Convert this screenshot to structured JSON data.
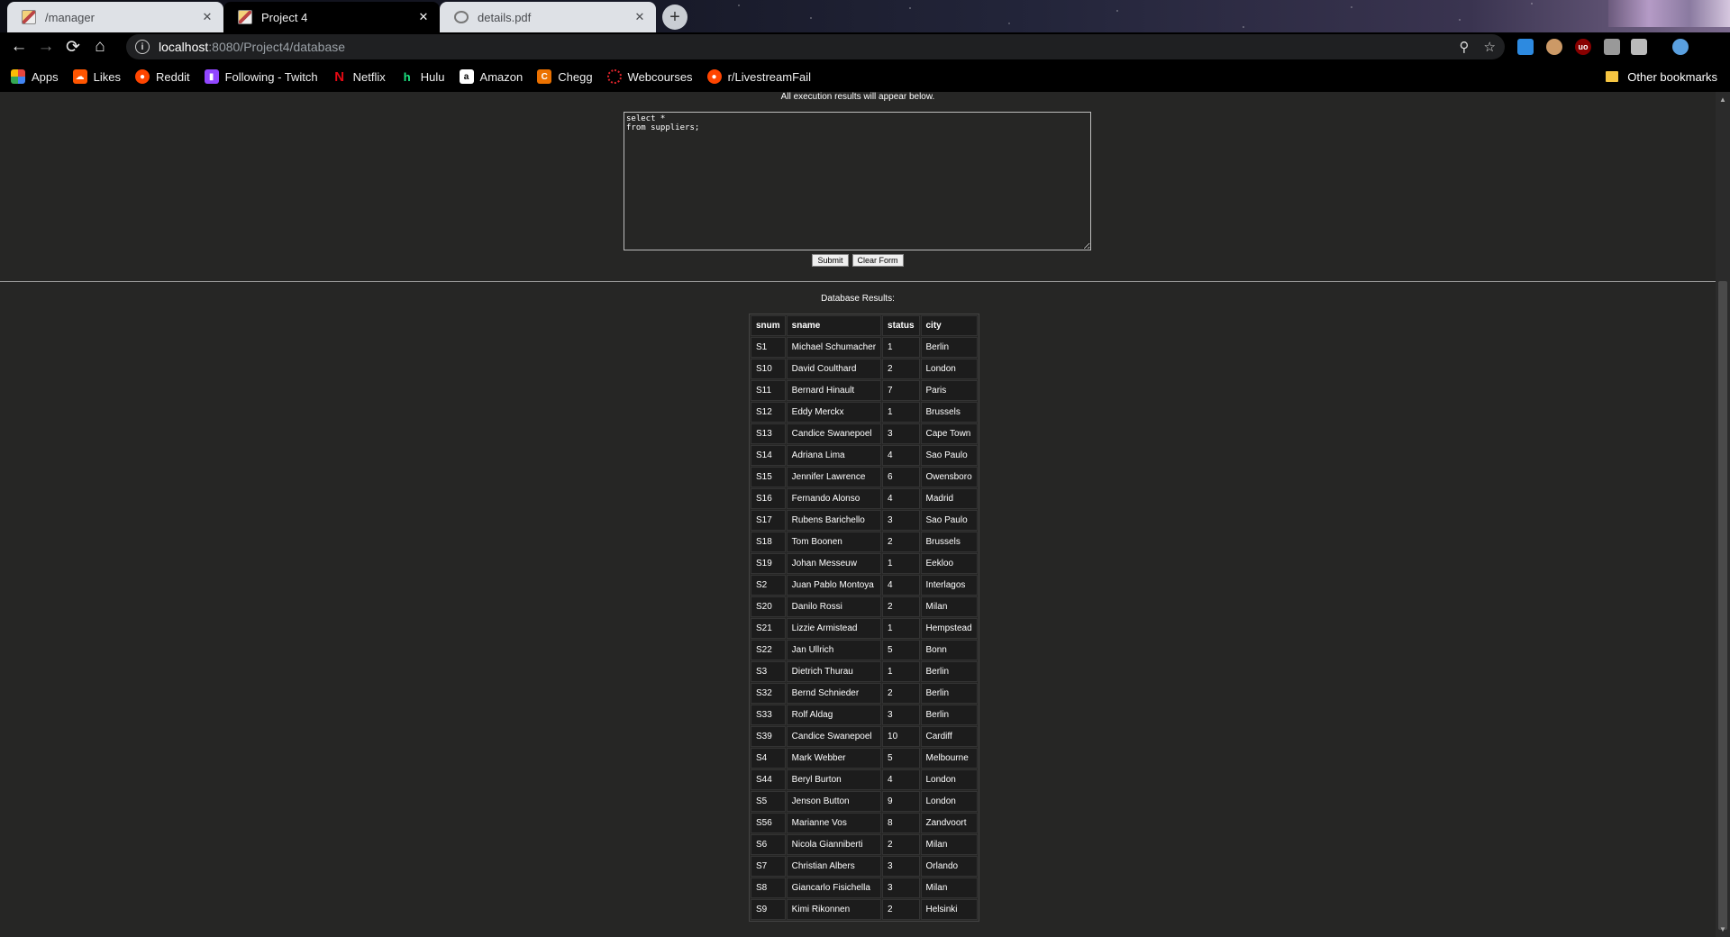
{
  "browser": {
    "tabs": [
      {
        "title": "/manager",
        "active": false,
        "icon": "cat-favicon-icon"
      },
      {
        "title": "Project 4",
        "active": true,
        "icon": "cat-favicon-icon"
      },
      {
        "title": "details.pdf",
        "active": false,
        "icon": "globe-icon"
      }
    ],
    "new_tab": "+",
    "close": "✕",
    "url_host": "localhost",
    "url_path": ":8080/Project4/database",
    "bookmarks": [
      {
        "label": "Apps",
        "icon": "apps-grid-icon",
        "color": "#e8453c"
      },
      {
        "label": "Likes",
        "icon": "soundcloud-icon",
        "color": "#ff5500"
      },
      {
        "label": "Reddit",
        "icon": "reddit-icon",
        "color": "#ff4500"
      },
      {
        "label": "Following - Twitch",
        "icon": "twitch-icon",
        "color": "#9146ff"
      },
      {
        "label": "Netflix",
        "icon": "netflix-icon",
        "color": "#e50914"
      },
      {
        "label": "Hulu",
        "icon": "hulu-icon",
        "color": "#1ce783"
      },
      {
        "label": "Amazon",
        "icon": "amazon-icon",
        "color": "#ffffff"
      },
      {
        "label": "Chegg",
        "icon": "chegg-icon",
        "color": "#eb7100"
      },
      {
        "label": "Webcourses",
        "icon": "webcourses-icon",
        "color": "#e0242b"
      },
      {
        "label": "r/LivestreamFail",
        "icon": "reddit-icon",
        "color": "#ff4500"
      }
    ],
    "other_bookmarks": "Other bookmarks"
  },
  "page": {
    "exec_note": "All execution results will appear below.",
    "sql_text": "select *\nfrom suppliers;",
    "submit_label": "Submit",
    "clear_label": "Clear Form",
    "results_label": "Database Results:"
  },
  "table": {
    "headers": [
      "snum",
      "sname",
      "status",
      "city"
    ],
    "rows": [
      [
        "S1",
        "Michael Schumacher",
        "1",
        "Berlin"
      ],
      [
        "S10",
        "David Coulthard",
        "2",
        "London"
      ],
      [
        "S11",
        "Bernard Hinault",
        "7",
        "Paris"
      ],
      [
        "S12",
        "Eddy Merckx",
        "1",
        "Brussels"
      ],
      [
        "S13",
        "Candice Swanepoel",
        "3",
        "Cape Town"
      ],
      [
        "S14",
        "Adriana Lima",
        "4",
        "Sao Paulo"
      ],
      [
        "S15",
        "Jennifer Lawrence",
        "6",
        "Owensboro"
      ],
      [
        "S16",
        "Fernando Alonso",
        "4",
        "Madrid"
      ],
      [
        "S17",
        "Rubens Barichello",
        "3",
        "Sao Paulo"
      ],
      [
        "S18",
        "Tom Boonen",
        "2",
        "Brussels"
      ],
      [
        "S19",
        "Johan Messeuw",
        "1",
        "Eekloo"
      ],
      [
        "S2",
        "Juan Pablo Montoya",
        "4",
        "Interlagos"
      ],
      [
        "S20",
        "Danilo Rossi",
        "2",
        "Milan"
      ],
      [
        "S21",
        "Lizzie Armistead",
        "1",
        "Hempstead"
      ],
      [
        "S22",
        "Jan Ullrich",
        "5",
        "Bonn"
      ],
      [
        "S3",
        "Dietrich Thurau",
        "1",
        "Berlin"
      ],
      [
        "S32",
        "Bernd Schnieder",
        "2",
        "Berlin"
      ],
      [
        "S33",
        "Rolf Aldag",
        "3",
        "Berlin"
      ],
      [
        "S39",
        "Candice Swanepoel",
        "10",
        "Cardiff"
      ],
      [
        "S4",
        "Mark Webber",
        "5",
        "Melbourne"
      ],
      [
        "S44",
        "Beryl Burton",
        "4",
        "London"
      ],
      [
        "S5",
        "Jenson Button",
        "9",
        "London"
      ],
      [
        "S56",
        "Marianne Vos",
        "8",
        "Zandvoort"
      ],
      [
        "S6",
        "Nicola Gianniberti",
        "2",
        "Milan"
      ],
      [
        "S7",
        "Christian Albers",
        "3",
        "Orlando"
      ],
      [
        "S8",
        "Giancarlo Fisichella",
        "3",
        "Milan"
      ],
      [
        "S9",
        "Kimi Rikonnen",
        "2",
        "Helsinki"
      ]
    ]
  }
}
